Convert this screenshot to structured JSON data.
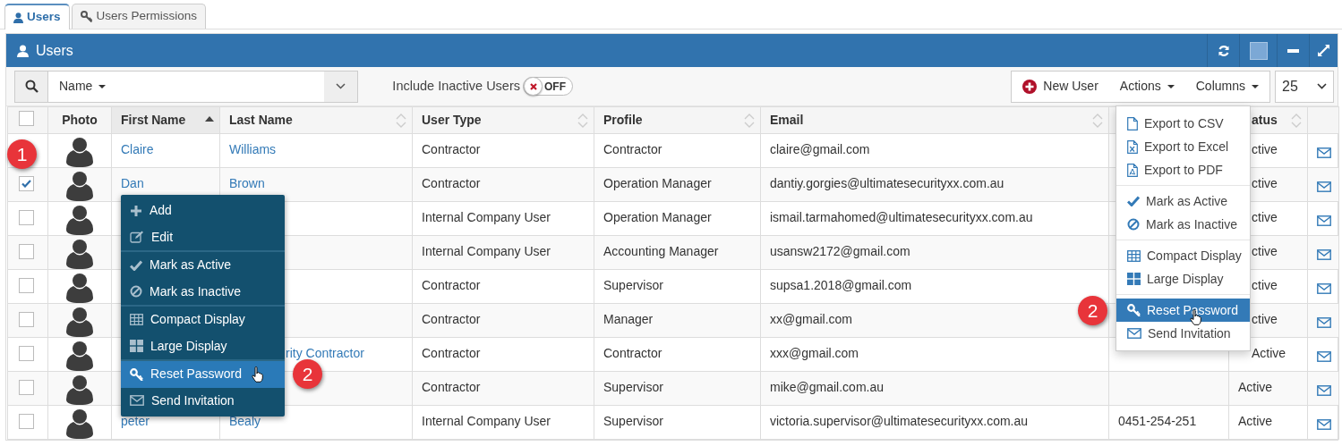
{
  "tabs": [
    {
      "label": "Users",
      "selected": true,
      "kind": "user"
    },
    {
      "label": "Users Permissions",
      "selected": false,
      "kind": "key"
    }
  ],
  "panel": {
    "title": "Users"
  },
  "toolbar": {
    "filter_label": "Name",
    "include_inactive": {
      "label": "Include Inactive Users",
      "on": false,
      "state_text": "OFF"
    },
    "buttons": [
      {
        "label": "New User",
        "kind": "new"
      },
      {
        "label": "Actions",
        "kind": "dropdown"
      },
      {
        "label": "Columns",
        "kind": "dropdown"
      }
    ],
    "page_size": "25"
  },
  "table": {
    "select_all_checked": false,
    "columns": {
      "photo": {
        "label": "Photo"
      },
      "first_name": {
        "label": "First Name",
        "sorted": true
      },
      "last_name": {
        "label": "Last Name",
        "sorted": false
      },
      "user_type": {
        "label": "User Type",
        "sorted": false
      },
      "profile": {
        "label": "Profile",
        "sorted": false
      },
      "email": {
        "label": "Email",
        "sorted": false
      },
      "status": {
        "label": "atus",
        "sorted": false
      }
    },
    "rows": [
      {
        "first_name": "Claire",
        "last_name": "Williams",
        "user_type": "Contractor",
        "profile": "Contractor",
        "email": "claire@gmail.com",
        "status": "ctive"
      },
      {
        "checked": true,
        "first_name": "Dan",
        "last_name": "Brown",
        "user_type": "Contractor",
        "profile": "Operation Manager",
        "email": "dantiy.gorgies@ultimatesecurityxx.com.au",
        "status": "ctive"
      },
      {
        "checked": false,
        "user_type": "Internal Company User",
        "profile": "Operation Manager",
        "email": "ismail.tarmahomed@ultimatesecurityxx.com.au",
        "status": "ctive"
      },
      {
        "checked": false,
        "user_type": "Internal Company User",
        "profile": "Accounting Manager",
        "email": "usansw2172@gmail.com",
        "status": "ctive"
      },
      {
        "checked": false,
        "user_type": "Contractor",
        "profile": "Supervisor",
        "email": "supsa1.2018@gmail.com",
        "status": "ctive"
      },
      {
        "checked": false,
        "user_type": "Contractor",
        "profile": "Manager",
        "email": "xx@gmail.com",
        "status": "ctive"
      },
      {
        "checked": false,
        "last_name": "rity Contractor",
        "user_type": "Contractor",
        "profile": "Contractor",
        "email": "xxx@gmail.com",
        "status": "Active"
      },
      {
        "checked": false,
        "user_type": "Contractor",
        "profile": "Supervisor",
        "email": "mike@gmail.com.au",
        "status": "Active"
      },
      {
        "checked": false,
        "first_name": "peter",
        "last_name": "Bealy",
        "user_type": "Internal Company User",
        "profile": "Supervisor",
        "email": "victoria.supervisor@ultimatesecurityxx.com.au",
        "column_8": "0451-254-251",
        "status": "Active"
      }
    ]
  },
  "context_menu": {
    "groups": [
      {
        "items": [
          {
            "label": "Add",
            "kind": "add",
            "selected": false
          },
          {
            "label": "Edit",
            "kind": "edit",
            "selected": false
          }
        ]
      },
      {
        "items": [
          {
            "label": "Mark as Active",
            "kind": "activate",
            "selected": false
          },
          {
            "label": "Mark as Inactive",
            "kind": "deactivate",
            "selected": false
          }
        ]
      },
      {
        "items": [
          {
            "label": "Compact Display",
            "kind": "compact",
            "selected": false
          },
          {
            "label": "Large Display",
            "kind": "large",
            "selected": false
          }
        ]
      },
      {
        "items": [
          {
            "label": "Reset Password",
            "kind": "reset",
            "selected": true
          },
          {
            "label": "Send Invitation",
            "kind": "invite",
            "selected": false
          }
        ]
      }
    ]
  },
  "actions_menu": {
    "groups": [
      {
        "items": [
          {
            "label": "Export to CSV",
            "kind": "csv",
            "selected": false
          },
          {
            "label": "Export to Excel",
            "kind": "excel",
            "selected": false
          },
          {
            "label": "Export to PDF",
            "kind": "pdf",
            "selected": false
          }
        ]
      },
      {
        "items": [
          {
            "label": "Mark as Active",
            "kind": "activate",
            "selected": false
          },
          {
            "label": "Mark as Inactive",
            "kind": "deactivate",
            "selected": false
          }
        ]
      },
      {
        "items": [
          {
            "label": "Compact Display",
            "kind": "compact",
            "selected": false
          },
          {
            "label": "Large Display",
            "kind": "large",
            "selected": false
          }
        ]
      },
      {
        "items": [
          {
            "label": "Reset Password",
            "kind": "reset",
            "selected": true
          },
          {
            "label": "Send Invitation",
            "kind": "invite",
            "selected": false
          }
        ]
      }
    ]
  },
  "step_markers": [
    {
      "label": "1",
      "kind": "row"
    },
    {
      "label": "2",
      "kind": "context"
    },
    {
      "label": "2",
      "kind": "actions"
    }
  ]
}
